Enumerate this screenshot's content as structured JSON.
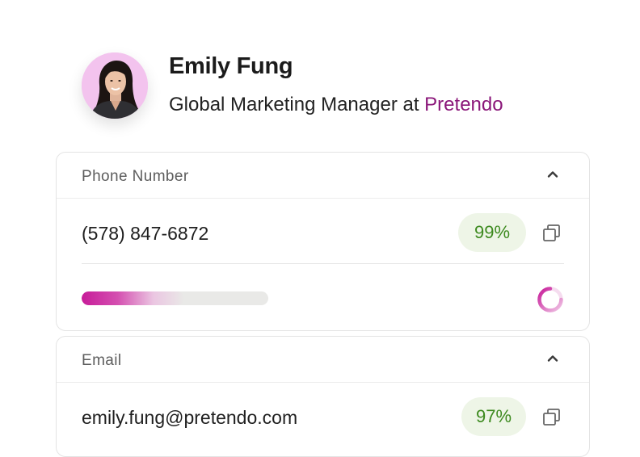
{
  "profile": {
    "name": "Emily Fung",
    "title_prefix": "Global Marketing Manager at ",
    "company": "Pretendo"
  },
  "phone_card": {
    "label": "Phone Number",
    "value": "(578) 847-6872",
    "confidence": "99%",
    "progress_fraction": 0.55,
    "expanded": true
  },
  "email_card": {
    "label": "Email",
    "value": "emily.fung@pretendo.com",
    "confidence": "97%",
    "expanded": true
  },
  "colors": {
    "accent": "#8a1679",
    "progress": "#c71c99",
    "badge_bg": "#eef5e7",
    "badge_text": "#3d8a1f",
    "avatar_bg": "#f3c3ee"
  },
  "icons": {
    "collapse": "chevron-up-icon",
    "copy": "copy-icon",
    "loading": "spinner-icon"
  }
}
